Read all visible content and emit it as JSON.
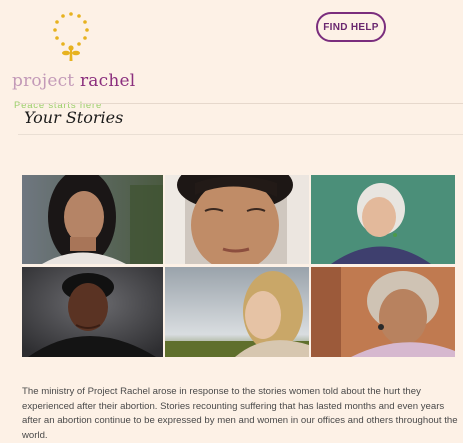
{
  "header": {
    "brand_part1": "project ",
    "brand_part2": "rachel",
    "tagline": "Peace starts here",
    "find_help_label": "FIND HELP"
  },
  "main": {
    "title": "Your Stories",
    "intro_text": "The ministry of Project Rachel arose in response to the stories women told about the hurt they experienced after their abortion. Stories recounting suffering that has lasted months and even years after an abortion continue to be expressed by men and women in our offices and others throughout the world."
  },
  "colors": {
    "page_background": "#fdf1e6",
    "brand_light": "#c39ab8",
    "brand_dark": "#8b2f7e",
    "tagline": "#9bd06b",
    "logo_gold": "#e7b21f",
    "button_border": "#7a2d7d"
  },
  "icons": {
    "logo": "dotted-circle-with-rose-icon"
  }
}
